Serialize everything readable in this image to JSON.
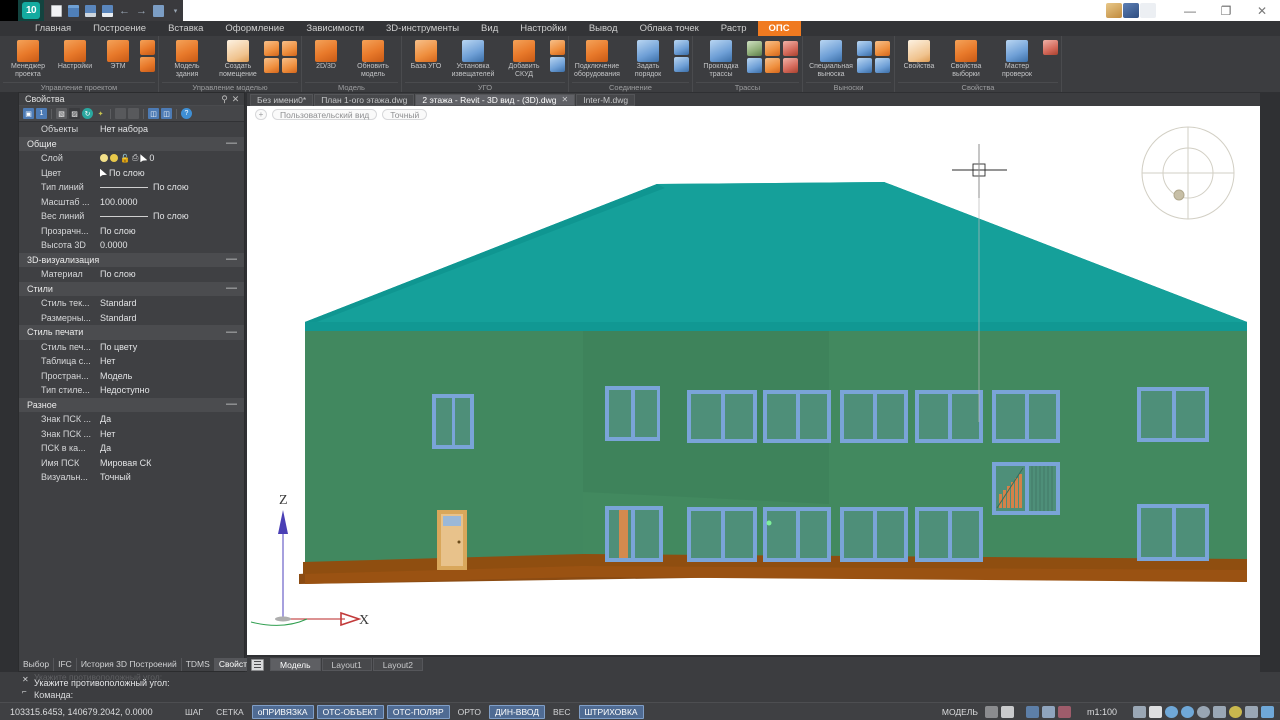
{
  "titlebar": {
    "logo_text": "10",
    "quick_access": [
      {
        "name": "new-file",
        "icon": "document"
      },
      {
        "name": "open-folder",
        "icon": "folder"
      },
      {
        "name": "save",
        "icon": "floppy"
      },
      {
        "name": "save-as",
        "icon": "floppy-check"
      },
      {
        "name": "undo",
        "icon": "←"
      },
      {
        "name": "redo",
        "icon": "→"
      },
      {
        "name": "print",
        "icon": "printer"
      },
      {
        "name": "more",
        "icon": "▾"
      }
    ],
    "window_controls": {
      "minimize": "—",
      "maximize": "❐",
      "close": "✕"
    }
  },
  "ribbon_tabs": [
    {
      "label": "Главная",
      "active": false
    },
    {
      "label": "Построение",
      "active": false
    },
    {
      "label": "Вставка",
      "active": false
    },
    {
      "label": "Оформление",
      "active": false
    },
    {
      "label": "Зависимости",
      "active": false
    },
    {
      "label": "3D-инструменты",
      "active": false
    },
    {
      "label": "Вид",
      "active": false
    },
    {
      "label": "Настройки",
      "active": false
    },
    {
      "label": "Вывод",
      "active": false
    },
    {
      "label": "Облака точек",
      "active": false
    },
    {
      "label": "Растр",
      "active": false
    },
    {
      "label": "ОПС",
      "active": true
    }
  ],
  "ribbon_groups": [
    {
      "title": "Управление проектом",
      "buttons": [
        {
          "label": "Менеджер проекта",
          "icon": "project-manager-icon",
          "style": "ic-or"
        },
        {
          "label": "Настройки",
          "icon": "settings-gear-icon",
          "style": "ic-or"
        },
        {
          "label": "ЭТМ",
          "icon": "etm-icon",
          "style": "ic-or"
        }
      ],
      "small": [
        {
          "icon": "layers-icon",
          "style": "ic-or"
        },
        {
          "icon": "database-icon",
          "style": "ic-or"
        }
      ]
    },
    {
      "title": "Управление моделью",
      "buttons": [
        {
          "label": "Модель здания",
          "icon": "building-model-icon",
          "style": "ic-or"
        },
        {
          "label": "Создать помещение",
          "icon": "create-room-icon",
          "style": "ic-wh"
        }
      ],
      "small": [
        {
          "icon": "room-copy-icon",
          "style": "ic-or2"
        },
        {
          "icon": "room-delete-icon",
          "style": "ic-or2"
        },
        {
          "icon": "room-tool-icon",
          "style": "ic-or2"
        },
        {
          "icon": "room-chart-icon",
          "style": "ic-or2"
        }
      ]
    },
    {
      "title": "Модель",
      "buttons": [
        {
          "label": "2D/3D",
          "icon": "toggle-2d-3d-icon",
          "style": "ic-or"
        },
        {
          "label": "Обновить модель",
          "icon": "refresh-model-icon",
          "style": "ic-or"
        }
      ],
      "small": []
    },
    {
      "title": "УГО",
      "buttons": [
        {
          "label": "База УГО",
          "icon": "ugo-database-icon",
          "style": "ic-or2"
        },
        {
          "label": "Установка извещателей",
          "icon": "install-detectors-icon",
          "style": "ic-bl"
        },
        {
          "label": "Добавить СКУД",
          "icon": "add-skud-icon",
          "style": "ic-or"
        }
      ],
      "small": [
        {
          "icon": "ugo-edit-icon",
          "style": "ic-or2"
        },
        {
          "icon": "ugo-settings-icon",
          "style": "ic-bl"
        }
      ]
    },
    {
      "title": "Соединение",
      "buttons": [
        {
          "label": "Подключение оборудования",
          "icon": "connect-equipment-icon",
          "style": "ic-or"
        },
        {
          "label": "Задать порядок",
          "icon": "set-order-icon",
          "style": "ic-bl"
        }
      ],
      "small": [
        {
          "icon": "order-1-icon",
          "style": "ic-bl"
        },
        {
          "icon": "order-2-icon",
          "style": "ic-bl"
        }
      ]
    },
    {
      "title": "Трассы",
      "buttons": [
        {
          "label": "Прокладка трассы",
          "icon": "route-laying-icon",
          "style": "ic-bl"
        }
      ],
      "small": [
        {
          "icon": "route-edit-icon",
          "style": "ic-gr"
        },
        {
          "icon": "route-node-icon",
          "style": "ic-or2"
        },
        {
          "icon": "route-bend-icon",
          "style": "ic-rd"
        },
        {
          "icon": "route-cloud-icon",
          "style": "ic-bl"
        },
        {
          "icon": "route-split-icon",
          "style": "ic-or2"
        },
        {
          "icon": "route-table-icon",
          "style": "ic-rd"
        }
      ]
    },
    {
      "title": "Выноски",
      "buttons": [
        {
          "label": "Специальная выноска",
          "icon": "special-callout-icon",
          "style": "ic-bl"
        }
      ],
      "small": [
        {
          "icon": "callout-align-icon",
          "style": "ic-bl"
        },
        {
          "icon": "callout-list-icon",
          "style": "ic-or2"
        },
        {
          "icon": "callout-edit-icon",
          "style": "ic-bl"
        },
        {
          "icon": "callout-settings-icon",
          "style": "ic-bl"
        }
      ]
    },
    {
      "title": "Свойства",
      "buttons": [
        {
          "label": "Свойства",
          "icon": "properties-icon",
          "style": "ic-wh"
        },
        {
          "label": "Свойства выборки",
          "icon": "selection-properties-icon",
          "style": "ic-or"
        },
        {
          "label": "Мастер проверок",
          "icon": "check-wizard-icon",
          "style": "ic-bl"
        }
      ],
      "small": [
        {
          "icon": "check-report-icon",
          "style": "ic-rd"
        }
      ]
    }
  ],
  "properties_panel": {
    "title": "Свойства",
    "pin_icon": "pin-icon",
    "close_icon": "close-icon",
    "toolbar_icons": [
      "select-object-icon",
      "quick-select-icon",
      "sep",
      "pick-point-icon",
      "pick-window-icon",
      "cycle-icon",
      "highlight-icon",
      "sep",
      "lock-icon",
      "unlock-icon",
      "sep",
      "grid-left-icon",
      "grid-right-icon",
      "sep",
      "help-icon"
    ],
    "object_row": {
      "key": "Объекты",
      "value": "Нет набора"
    },
    "sections": [
      {
        "title": "Общие",
        "rows": [
          {
            "key": "Слой",
            "value": "0",
            "type": "layer"
          },
          {
            "key": "Цвет",
            "value": "По слою",
            "type": "color"
          },
          {
            "key": "Тип линий",
            "value": "По слою",
            "type": "line"
          },
          {
            "key": "Масштаб ...",
            "value": "100.0000",
            "type": "text"
          },
          {
            "key": "Вес линий",
            "value": "По слою",
            "type": "line"
          },
          {
            "key": "Прозрачн...",
            "value": "По слою",
            "type": "text"
          },
          {
            "key": "Высота 3D",
            "value": "0.0000",
            "type": "text"
          }
        ]
      },
      {
        "title": "3D-визуализация",
        "rows": [
          {
            "key": "Материал",
            "value": "По слою",
            "type": "text"
          }
        ]
      },
      {
        "title": "Стили",
        "rows": [
          {
            "key": "Стиль тек...",
            "value": "Standard",
            "type": "text"
          },
          {
            "key": "Размерны...",
            "value": "Standard",
            "type": "text"
          }
        ]
      },
      {
        "title": "Стиль печати",
        "rows": [
          {
            "key": "Стиль печ...",
            "value": "По цвету",
            "type": "text"
          },
          {
            "key": "Таблица с...",
            "value": "Нет",
            "type": "text"
          },
          {
            "key": "Простран...",
            "value": "Модель",
            "type": "text"
          },
          {
            "key": "Тип стиле...",
            "value": "Недоступно",
            "type": "text"
          }
        ]
      },
      {
        "title": "Разное",
        "rows": [
          {
            "key": "Знак ПСК ...",
            "value": "Да",
            "type": "text"
          },
          {
            "key": "Знак ПСК ...",
            "value": "Нет",
            "type": "text"
          },
          {
            "key": "ПСК в ка...",
            "value": "Да",
            "type": "text"
          },
          {
            "key": "Имя ПСК",
            "value": "Мировая СК",
            "type": "text"
          },
          {
            "key": "Визуальн...",
            "value": "Точный",
            "type": "text"
          }
        ]
      }
    ],
    "bottom_tabs": [
      {
        "label": "Выбор",
        "active": false
      },
      {
        "label": "IFC",
        "active": false
      },
      {
        "label": "История 3D Построений",
        "active": false
      },
      {
        "label": "TDMS",
        "active": false
      },
      {
        "label": "Свойства",
        "active": true
      }
    ]
  },
  "document_tabs": [
    {
      "label": "Без имени0*",
      "active": false,
      "closable": false
    },
    {
      "label": "План 1-ого этажа.dwg",
      "active": false,
      "closable": false
    },
    {
      "label": "2 этажа - Revit - 3D вид - (3D).dwg",
      "active": true,
      "closable": true
    },
    {
      "label": "Inter-M.dwg",
      "active": false,
      "closable": false
    }
  ],
  "view_controls": [
    {
      "label": "+",
      "name": "view-expand-button"
    },
    {
      "label": "Пользовательский вид",
      "name": "view-preset-button"
    },
    {
      "label": "Точный",
      "name": "visual-style-button"
    }
  ],
  "viewport": {
    "axis_z_label": "Z",
    "axis_x_label": "X",
    "navcube": "orbit-navigation-widget",
    "crosshair": "crosshair-cursor",
    "colors": {
      "roof": "#15a09a",
      "roof_shadow": "#0e8a86",
      "wall_front": "#40855f",
      "wall_side": "#3f8a63",
      "foundation": "#8a4a11",
      "window_frame": "#6f9cd4",
      "window_glass": "#4f8f79",
      "door": "#e0a857",
      "background": "#ffffff"
    }
  },
  "model_tabs": {
    "layout_icon": "layout-list-icon",
    "tabs": [
      {
        "label": "Модель",
        "active": true
      },
      {
        "label": "Layout1",
        "active": false
      },
      {
        "label": "Layout2",
        "active": false
      }
    ]
  },
  "command_line": {
    "history_faded": "Укажите противоположный угол:",
    "history": "Укажите противоположный угол:",
    "prompt": "Команда:",
    "close_icon": "close-icon",
    "arrow_icon": "expand-icon"
  },
  "status_bar": {
    "coordinates": "103315.6453, 140679.2042, 0.0000",
    "toggles": [
      {
        "label": "ШАГ",
        "on": false
      },
      {
        "label": "СЕТКА",
        "on": false
      },
      {
        "label": "оПРИВЯЗКА",
        "on": true
      },
      {
        "label": "ОТС-ОБЪЕКТ",
        "on": true
      },
      {
        "label": "ОТС-ПОЛЯР",
        "on": true
      },
      {
        "label": "ОРТО",
        "on": false
      },
      {
        "label": "ДИН-ВВОД",
        "on": true
      },
      {
        "label": "ВЕС",
        "on": false
      },
      {
        "label": "ШТРИХОВКА",
        "on": true
      }
    ],
    "space_label": "МОДЕЛЬ",
    "scale": "m1:100",
    "right_icons": [
      {
        "name": "annotation-scale-icon",
        "color": "#b9c6d8"
      },
      {
        "name": "annotation-visibility-icon",
        "color": "#e8e9eb"
      },
      {
        "name": "annotation-add-icon",
        "color": "#c96a6a"
      },
      {
        "name": "workspace-icon",
        "color": "#9aa7b5"
      },
      {
        "name": "pan-icon",
        "color": "#dedfe1"
      },
      {
        "name": "zoom-icon",
        "color": "#6fa8d8"
      },
      {
        "name": "orbit-icon",
        "color": "#6fa8d8"
      },
      {
        "name": "zoom-window-icon",
        "color": "#98a5b3"
      },
      {
        "name": "clean-screen-icon",
        "color": "#9aa7b5"
      },
      {
        "name": "hardware-accel-icon",
        "color": "#c9b84e"
      },
      {
        "name": "lock-ui-icon",
        "color": "#9aa7b5"
      },
      {
        "name": "fullscreen-icon",
        "color": "#6fa8d8"
      }
    ]
  }
}
